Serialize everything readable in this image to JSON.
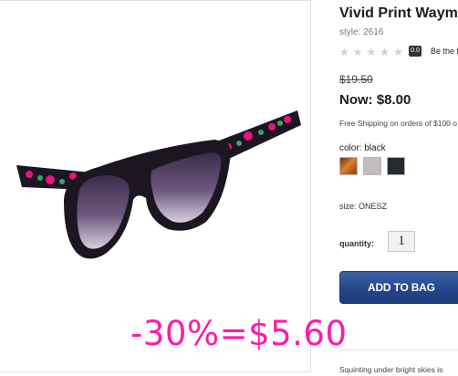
{
  "product": {
    "title": "Vivid Print Wayma",
    "style_label": "style: 2616",
    "rating": {
      "stars_icon": "star-icon",
      "stars_filled": 0,
      "stars_total": 5,
      "badge": "0.0",
      "text": "Be the f"
    },
    "price_old": "$19.50",
    "price_now": "Now: $8.00",
    "shipping": "Free Shipping on orders of $100 o",
    "color_label": "color: black",
    "swatches": [
      {
        "name": "tortoise",
        "color": "#b0641f"
      },
      {
        "name": "grey",
        "color": "#c3bcc0"
      },
      {
        "name": "black",
        "color": "#262a33"
      }
    ],
    "size_label": "size: ONESZ",
    "quantity_label": "quantity:",
    "quantity_value": "1",
    "add_button": "ADD TO BAG",
    "description": "Squinting under bright skies is",
    "promo": "-30%=$5.60"
  },
  "colors": {
    "promo": "#ff1aa7",
    "button": "#24468a",
    "frame": "#1b1620",
    "lens": "#574567"
  }
}
